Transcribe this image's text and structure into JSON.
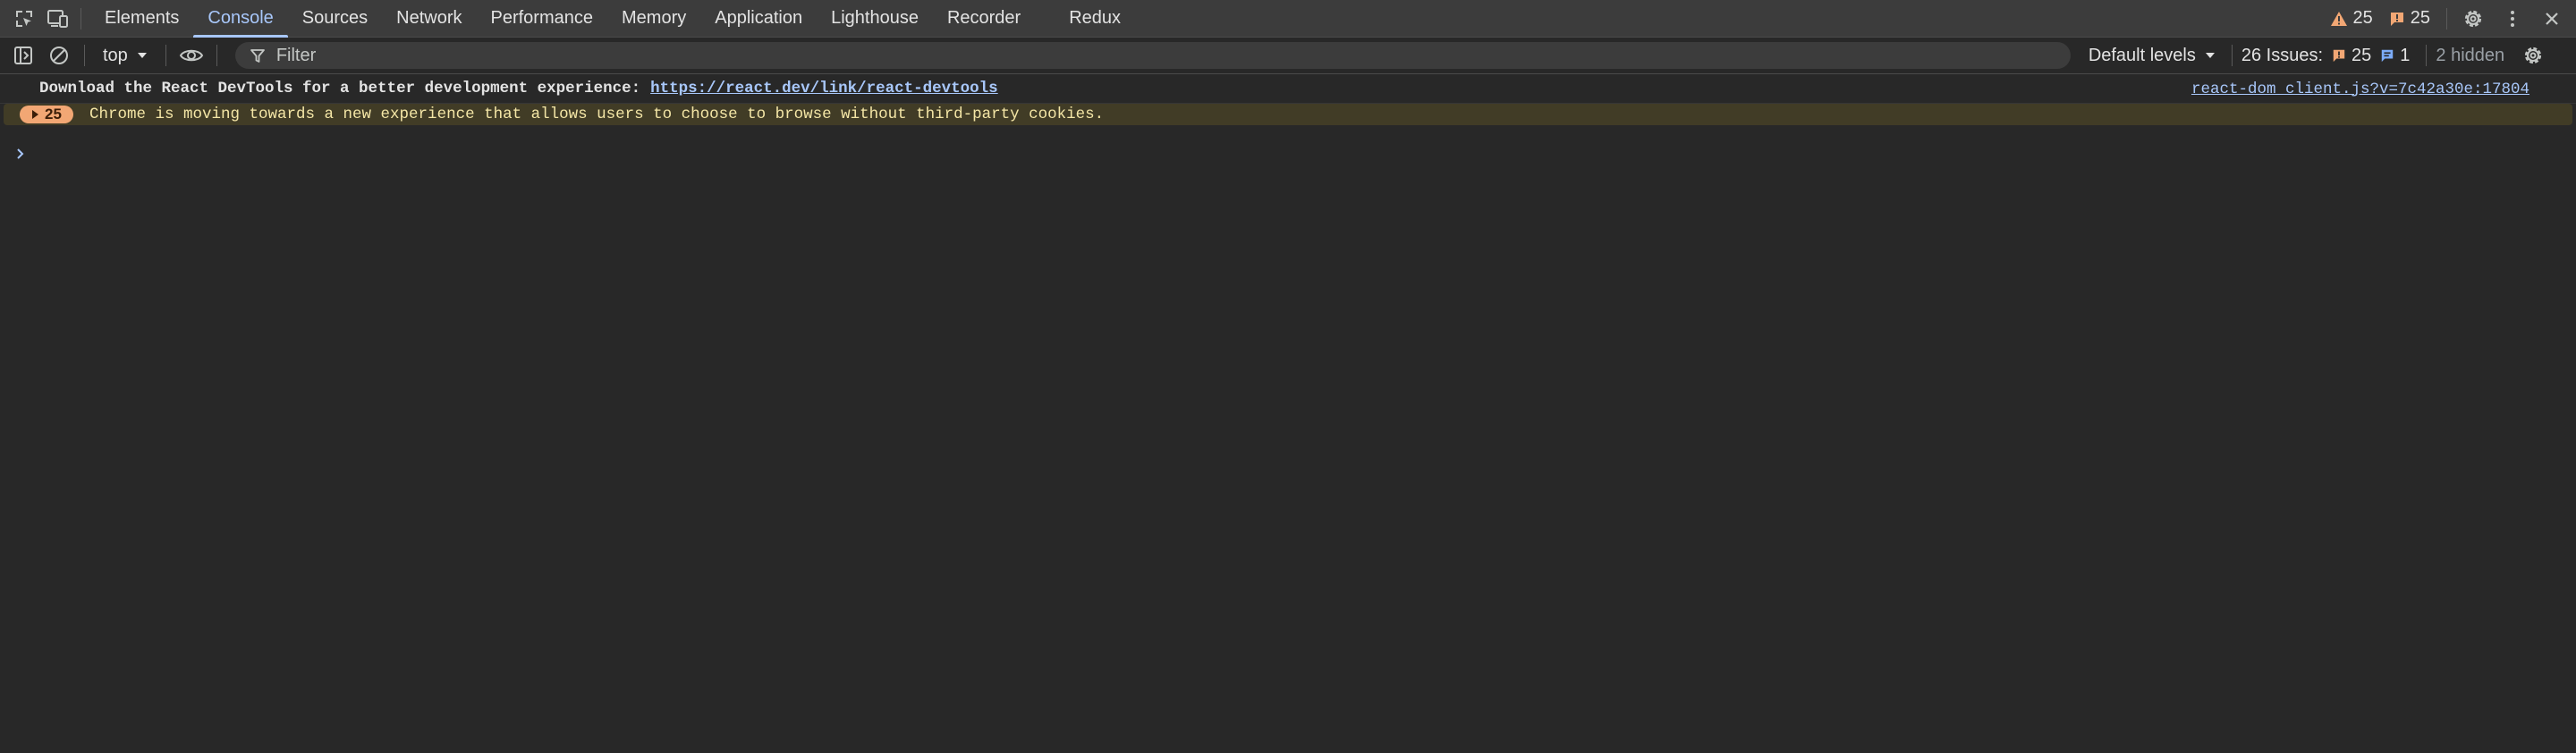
{
  "tabs": [
    {
      "label": "Elements"
    },
    {
      "label": "Console"
    },
    {
      "label": "Sources"
    },
    {
      "label": "Network"
    },
    {
      "label": "Performance"
    },
    {
      "label": "Memory"
    },
    {
      "label": "Application"
    },
    {
      "label": "Lighthouse"
    },
    {
      "label": "Recorder"
    },
    {
      "label": "Redux"
    }
  ],
  "active_tab": "Console",
  "header_counts": {
    "warnings": "25",
    "issues": "25"
  },
  "toolbar": {
    "context": "top",
    "filter_placeholder": "Filter",
    "levels": "Default levels",
    "issues_label": "26 Issues:",
    "issues_warn": "25",
    "issues_info": "1",
    "hidden": "2 hidden"
  },
  "messages": {
    "info": {
      "text": "Download the React DevTools for a better development experience:",
      "link": "https://react.dev/link/react-devtools",
      "source": "react-dom_client.js?v=7c42a30e:17804"
    },
    "warning": {
      "count": "25",
      "text": "Chrome is moving towards a new experience that allows users to choose to browse without third-party cookies."
    }
  },
  "colors": {
    "background": "#282828",
    "tabbar": "#3c3c3c",
    "accent": "#a8c7fa",
    "warning_bg": "#413c26",
    "warning_text": "#f4e6a6",
    "warning_icon": "#f2a774",
    "info_icon": "#7cacf8"
  }
}
